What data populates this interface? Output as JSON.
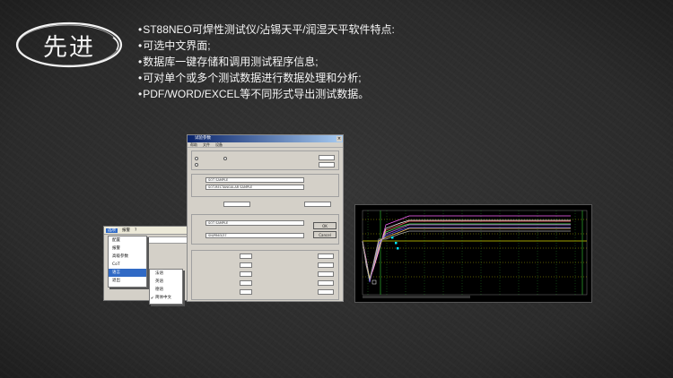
{
  "slide": {
    "badge_label": "先进",
    "bullets": [
      "ST88NEO可焊性测试仪/沾锡天平/润湿天平软件特点:",
      "可选中文界面;",
      "数据库一键存储和调用测试程序信息;",
      "可对单个或多个测试数据进行数据处理和分析;",
      "PDF/WORD/EXCEL等不同形式导出测试数据。"
    ]
  },
  "colors": {
    "background": "#2d2d2d",
    "chalk": "#f2f2f2",
    "chart_grid_x": "#2a9a2a",
    "chart_grid_y": "#d8d800",
    "chart_marker": "#00e5ff"
  },
  "menu_screenshot": {
    "menubar": [
      "选项",
      "报警",
      "?"
    ],
    "dropdown": [
      "配置",
      "报警",
      "高级参数",
      "CoT",
      "语言",
      "退出"
    ],
    "language_submenu": [
      "法语",
      "英语",
      "德语",
      "简体中文"
    ],
    "selected_language": "简体中文"
  },
  "dialog_screenshot": {
    "title": "试验参数",
    "menu": [
      "帮助",
      "文件",
      "设备"
    ],
    "fields": {
      "sample_name": "SOT SAMPLE",
      "sample_type": "SOT SAMPLE",
      "sample_shape": "SOT-RECTANGULAR SAMPLE",
      "flux_name": "SOT SAMPLE",
      "solder_name": "SN/PB63/37"
    },
    "buttons": [
      "OK",
      "Cancel"
    ]
  },
  "chart_screenshot": {
    "chart_data": {
      "type": "line",
      "series_count": 8,
      "note": "wetting balance force-time curves; curves dip sharply near start then rise and plateau"
    }
  }
}
